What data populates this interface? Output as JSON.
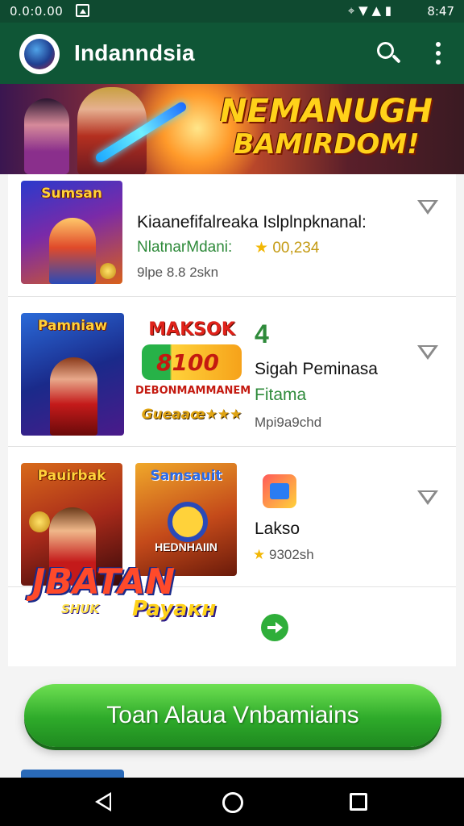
{
  "status_bar": {
    "left_text": "0.0:0.00",
    "time": "8:47",
    "signal_icons": "⌖ ▼ ▲ ▮"
  },
  "app_bar": {
    "title": "Indanndsia"
  },
  "banner": {
    "line1": "NEMANUGH",
    "line2": "BAMIRDOM!"
  },
  "list": [
    {
      "thumb_caption": "Sumsan",
      "title": "Kiaanefifalreaka Islplnpknanal:",
      "developer": "NlatnarMdani:",
      "rating": "00,234",
      "meta": "9lpe 8.8 2skn"
    },
    {
      "thumb_caption": "Pamniaw",
      "badge_title": "MAKSOK",
      "badge_amount": "8100",
      "badge_sub": "DEBONMAMMANEM",
      "badge_foot": "Gueaaœ★★★",
      "number": "4",
      "title": "Sigah Peminasa",
      "subtitle": "Fitama",
      "meta": "Mpi9a9chd"
    },
    {
      "thumb_caption_1": "Pauirbak",
      "thumb_caption_2": "Samsauit",
      "thumb_caption_2b": "HEDNHAIIN",
      "title": "Lakso",
      "rating": "9302sh"
    },
    {
      "promo_line1": "JBATAN",
      "promo_line2": "SHUK",
      "promo_line3": "Payaкн"
    }
  ],
  "cta": {
    "label": "Toan Alaua Vnbamiains"
  },
  "colors": {
    "app_bar": "#0f5636",
    "status_bar": "#0f4a30",
    "cta": "#2eaa2a",
    "rating": "#c49a12",
    "developer": "#2e8a3a"
  }
}
